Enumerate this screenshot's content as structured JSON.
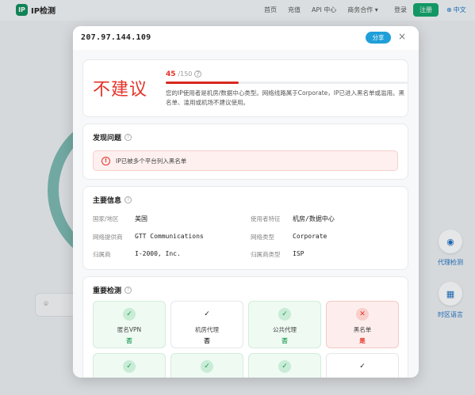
{
  "nav": {
    "logo_mark": "IP",
    "logo_text": "IP检测",
    "links": [
      "首页",
      "充值",
      "API 中心",
      "商务合作 ▾"
    ],
    "login": "登录",
    "register": "注册",
    "lang": "中文"
  },
  "side_tools": [
    {
      "label": "代理检测",
      "icon": "proxy-icon"
    },
    {
      "label": "时区语言",
      "icon": "timezone-icon"
    }
  ],
  "modal": {
    "ip": "207.97.144.109",
    "share": "分享",
    "close": "×",
    "risk": {
      "verdict": "不建议",
      "score": "45",
      "max": "/150",
      "score_fraction": 0.3,
      "description": "您的IP使用者是机房/数据中心类型。网络线路属于Corporate，IP已进入黑名单或滥用。黑名单、滥用或机场不建议使用。"
    },
    "issues": {
      "title": "发现问题",
      "alert": "IP已被多个平台列入黑名单"
    },
    "info": {
      "title": "主要信息",
      "rows": [
        {
          "label": "国家/地区",
          "value": "美国",
          "label2": "使用者特征",
          "value2": "机房/数据中心"
        },
        {
          "label": "网络提供商",
          "value": "GTT Communications",
          "label2": "网络类型",
          "value2": "Corporate"
        },
        {
          "label": "归属商",
          "value": "I-2000, Inc.",
          "label2": "归属商类型",
          "value2": "ISP"
        }
      ]
    },
    "detection": {
      "title": "重要检测",
      "items": [
        {
          "name": "匿名VPN",
          "result": "否",
          "status": "ok",
          "icon": "✓"
        },
        {
          "name": "机房代理",
          "result": "否",
          "status": "neutral",
          "icon": "✓"
        },
        {
          "name": "公共代理",
          "result": "否",
          "status": "ok",
          "icon": "✓"
        },
        {
          "name": "黑名单",
          "result": "是",
          "status": "bad",
          "icon": "✕"
        }
      ],
      "row2": [
        {
          "status": "ok",
          "icon": "✓"
        },
        {
          "status": "ok",
          "icon": "✓"
        },
        {
          "status": "ok",
          "icon": "✓"
        },
        {
          "status": "neutral",
          "icon": "✓"
        }
      ]
    }
  }
}
